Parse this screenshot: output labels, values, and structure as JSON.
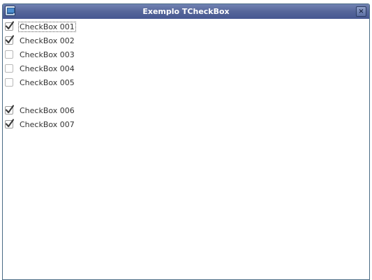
{
  "window": {
    "title": "Exemplo TCheckBox",
    "close_symbol": "×",
    "app_icon": "window-app-icon"
  },
  "checkboxes": [
    {
      "label": "CheckBox 001",
      "checked": true,
      "focused": true
    },
    {
      "label": "CheckBox 002",
      "checked": true,
      "focused": false
    },
    {
      "label": "CheckBox 003",
      "checked": false,
      "focused": false
    },
    {
      "label": "CheckBox 004",
      "checked": false,
      "focused": false
    },
    {
      "label": "CheckBox 005",
      "checked": false,
      "focused": false
    },
    {
      "label": "CheckBox 006",
      "checked": true,
      "focused": false
    },
    {
      "label": "CheckBox 007",
      "checked": true,
      "focused": false
    }
  ],
  "colors": {
    "titlebar": "#56669a",
    "check": "#3a3a3a",
    "text": "#333333"
  }
}
